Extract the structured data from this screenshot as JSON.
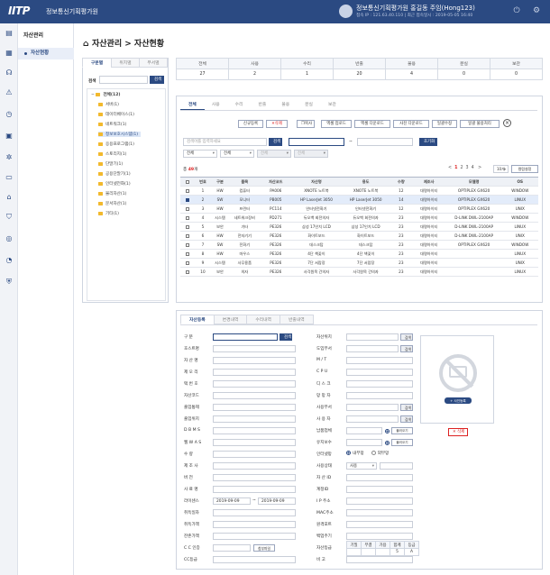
{
  "top": {
    "logo": "IITP",
    "org": "정보통신기획평가원",
    "user_name": "정보통신기획평가원 홍길동 주임(Hong123)",
    "user_info": "접속 IP : 121.63.40.110  |  최근 접속일시 : 2019-05-05 16:40",
    "icons": [
      "logout-icon",
      "gear-icon"
    ]
  },
  "rail": {
    "icons": [
      "document-icon",
      "grid-icon",
      "headset-icon",
      "warning-icon",
      "clock-icon",
      "calendar-icon",
      "gear-icon",
      "monitor-icon",
      "graduation-icon",
      "shield-icon",
      "globe-icon",
      "pie-icon",
      "lock-shield-icon"
    ]
  },
  "menu": {
    "title": "자산관리",
    "item": "자산현황"
  },
  "page_title": "자산관리 > 자산현황",
  "left": {
    "tabs": [
      "구분별",
      "위치별",
      "부서별"
    ],
    "search_label": "검색",
    "search_btn": "검색",
    "root": "전체(12)",
    "items": [
      "서버(1)",
      "데이터베이스(1)",
      "네트워크(1)",
      "정보보호시스템(1)",
      "응용프로그램(1)",
      "스토리지(1)",
      "단말기(1)",
      "공용단말기(1)",
      "인터넷전화(1)",
      "물리자산(1)",
      "문서자산(1)",
      "기타(1)"
    ],
    "selected_index": 3
  },
  "stats": {
    "headers": [
      "전체",
      "사용",
      "수리",
      "반출",
      "불용",
      "분실",
      "보관"
    ],
    "values": [
      "27",
      "2",
      "1",
      "20",
      "4",
      "0",
      "0"
    ]
  },
  "main_tabs": [
    "전체",
    "사용",
    "수리",
    "반출",
    "불용",
    "분실",
    "보관"
  ],
  "actions": {
    "register": "신규등록",
    "delete": "삭제",
    "copy": "복사",
    "excel_upload": "엑셀 업로드",
    "excel_download": "엑셀 다운로드",
    "photo_download": "사진 다운로드",
    "bulk_edit": "일괄수정",
    "bulk_unused": "일괄 불용처리"
  },
  "filter": {
    "search_placeholder": "검색어를 입력하세요",
    "search_btn": "검색",
    "date_sep": "~",
    "reset_btn": "초기화",
    "sel1": "전체",
    "sel2": "전체",
    "sel3": "전체",
    "sel4": "전체"
  },
  "list": {
    "total_label": "총",
    "total_count": "49",
    "total_unit": "개",
    "pages": [
      "1",
      "2",
      "3",
      "4"
    ],
    "page_prev": "<",
    "page_next": ">",
    "page_size": "10개",
    "column_btn": "컬럼설정",
    "headers": [
      "번호",
      "구분",
      "품목",
      "자산코드",
      "자산명",
      "용도",
      "수량",
      "제조사",
      "모델명",
      "OS"
    ],
    "rows": [
      [
        "1",
        "HW",
        "컴퓨터",
        "PA006",
        "XNOTE 노트북",
        "XNOTE 노트북",
        "12",
        "대명아이티",
        "OPTIPLEX GX620",
        "WINDOW"
      ],
      [
        "2",
        "SW",
        "모니터",
        "PB005",
        "HP LaserJet 3050",
        "HP LaserJet 3050",
        "14",
        "대명아이티",
        "OPTIPLEX GX620",
        "LINUX"
      ],
      [
        "3",
        "HW",
        "프린터",
        "PC114",
        "인터넷전화기",
        "인터넷전화기",
        "12",
        "대명아이티",
        "OPTIPLEX GX620",
        "UNIX"
      ],
      [
        "4",
        "시스템",
        "네트워크장비",
        "PD271",
        "듀오백 회전의자",
        "듀오백 회전의자",
        "23",
        "대명아이티",
        "D-LINK DWL-2100AP",
        "WINDOW"
      ],
      [
        "5",
        "보안",
        "기타",
        "PE326",
        "삼성 17인치 LCD",
        "삼성 17인치 LCD",
        "23",
        "대명아이티",
        "D-LINK DWL-2100AP",
        "LINUX"
      ],
      [
        "6",
        "HW",
        "전자기기",
        "PE326",
        "화이트보드",
        "화이트보드",
        "23",
        "대명아이티",
        "D-LINK DWL-2100AP",
        "UNIX"
      ],
      [
        "7",
        "SW",
        "전화기",
        "PE326",
        "데스크탑",
        "데스크탑",
        "23",
        "대명아이티",
        "OPTIPLEX GX620",
        "WINDOW"
      ],
      [
        "8",
        "HW",
        "마우스",
        "PE326",
        "4단 책꽂이",
        "4단 책꽂이",
        "23",
        "대명아이티",
        "",
        "LINUX"
      ],
      [
        "9",
        "시스템",
        "사무용품",
        "PE326",
        "7단 서랍장",
        "7단 서랍장",
        "23",
        "대명아이티",
        "",
        "UNIX"
      ],
      [
        "10",
        "보안",
        "의자",
        "PE326",
        "사각원목 간의자",
        "사각원목 간의자",
        "23",
        "대명아이티",
        "",
        "LINUX"
      ]
    ],
    "checked_index": 1
  },
  "detail": {
    "tabs": [
      "자산등록",
      "변경내역",
      "수리내역",
      "반출내역"
    ],
    "left_labels": [
      "구 분",
      "호스트명",
      "자 산 명",
      "제 오 리",
      "택 번 호",
      "자산코드",
      "출입통제",
      "출입위치",
      "D B M S",
      "웹 W A S",
      "수 량",
      "제 조 사",
      "버 전",
      "사 료 명",
      "라이센스",
      "취득일자",
      "취득가액",
      "잔존가액",
      "C C 인증",
      "CC등급"
    ],
    "right_labels": [
      "자산위치",
      "도입부서",
      "M / T",
      "C P U",
      "디 스 크",
      "망 망 자",
      "사용부서",
      "사 용 자",
      "납품업체",
      "유지보수",
      "인터넷망",
      "사용상태",
      "자 산 ID",
      "계정ID",
      "I P 주소",
      "MAC주소",
      "원격포트",
      "백업주기",
      "자산등급",
      "비 고"
    ],
    "gubun_btn": "검색",
    "loc_btn": "검색",
    "dept_btn": "검색",
    "user_dept_btn": "검색",
    "user_btn": "검색",
    "vendor_btn": "불러오기",
    "maint_btn": "불러오기",
    "cc_btn": "첨부파일",
    "date_from": "2019-09-09",
    "date_to": "2019-09-09",
    "date_sep": "~",
    "net_inner": "내부망",
    "net_outer": "외부망",
    "use_state": "사용",
    "grade_headers": [
      "기밀",
      "무결",
      "가용",
      "합계",
      "등급"
    ],
    "grade_values": [
      "",
      "",
      "",
      "5",
      "A"
    ],
    "photo_btn": "+ 사진등록",
    "photo_delete": "삭제"
  }
}
